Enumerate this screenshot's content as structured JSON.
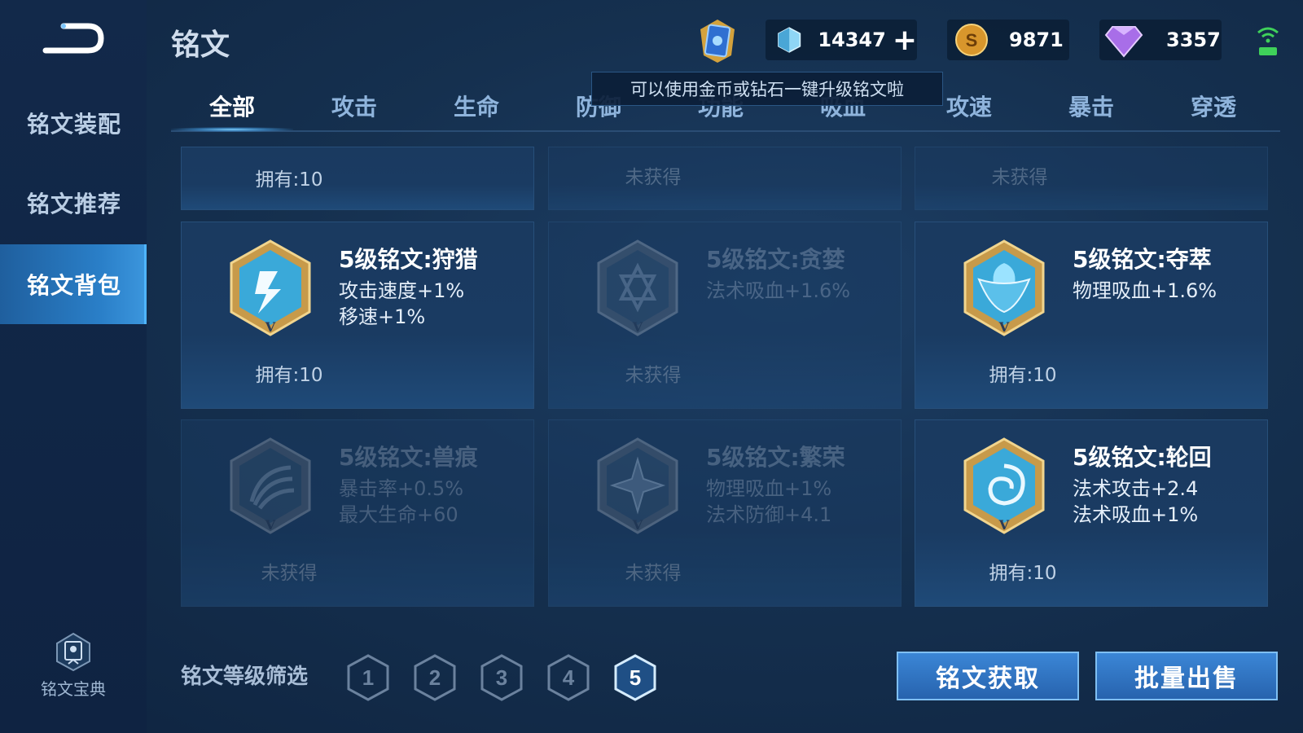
{
  "header": {
    "title": "铭文"
  },
  "resources": {
    "gem_value": "14347",
    "gold_value": "9871",
    "diamond_value": "3357"
  },
  "tooltip": "可以使用金币或钻石一键升级铭文啦",
  "sidebar": {
    "items": [
      {
        "label": "铭文装配"
      },
      {
        "label": "铭文推荐"
      },
      {
        "label": "铭文背包"
      }
    ],
    "codex_label": "铭文宝典"
  },
  "tabs": [
    {
      "label": "全部"
    },
    {
      "label": "攻击"
    },
    {
      "label": "生命"
    },
    {
      "label": "防御"
    },
    {
      "label": "功能"
    },
    {
      "label": "吸血"
    },
    {
      "label": "攻速"
    },
    {
      "label": "暴击"
    },
    {
      "label": "穿透"
    }
  ],
  "top_row": [
    {
      "owned": "拥有:10"
    },
    {
      "owned": "未获得"
    },
    {
      "owned": "未获得"
    }
  ],
  "cards": [
    {
      "name": "5级铭文:狩猎",
      "stats": [
        "攻击速度+1%",
        "移速+1%"
      ],
      "owned": "拥有:10"
    },
    {
      "name": "5级铭文:贪婪",
      "stats": [
        "法术吸血+1.6%",
        ""
      ],
      "owned": "未获得"
    },
    {
      "name": "5级铭文:夺萃",
      "stats": [
        "物理吸血+1.6%",
        ""
      ],
      "owned": "拥有:10"
    },
    {
      "name": "5级铭文:兽痕",
      "stats": [
        "暴击率+0.5%",
        "最大生命+60"
      ],
      "owned": "未获得"
    },
    {
      "name": "5级铭文:繁荣",
      "stats": [
        "物理吸血+1%",
        "法术防御+4.1"
      ],
      "owned": "未获得"
    },
    {
      "name": "5级铭文:轮回",
      "stats": [
        "法术攻击+2.4",
        "法术吸血+1%"
      ],
      "owned": "拥有:10"
    }
  ],
  "filter": {
    "label": "铭文等级筛选",
    "levels": [
      "1",
      "2",
      "3",
      "4",
      "5"
    ]
  },
  "actions": {
    "obtain": "铭文获取",
    "bulk_sell": "批量出售"
  }
}
